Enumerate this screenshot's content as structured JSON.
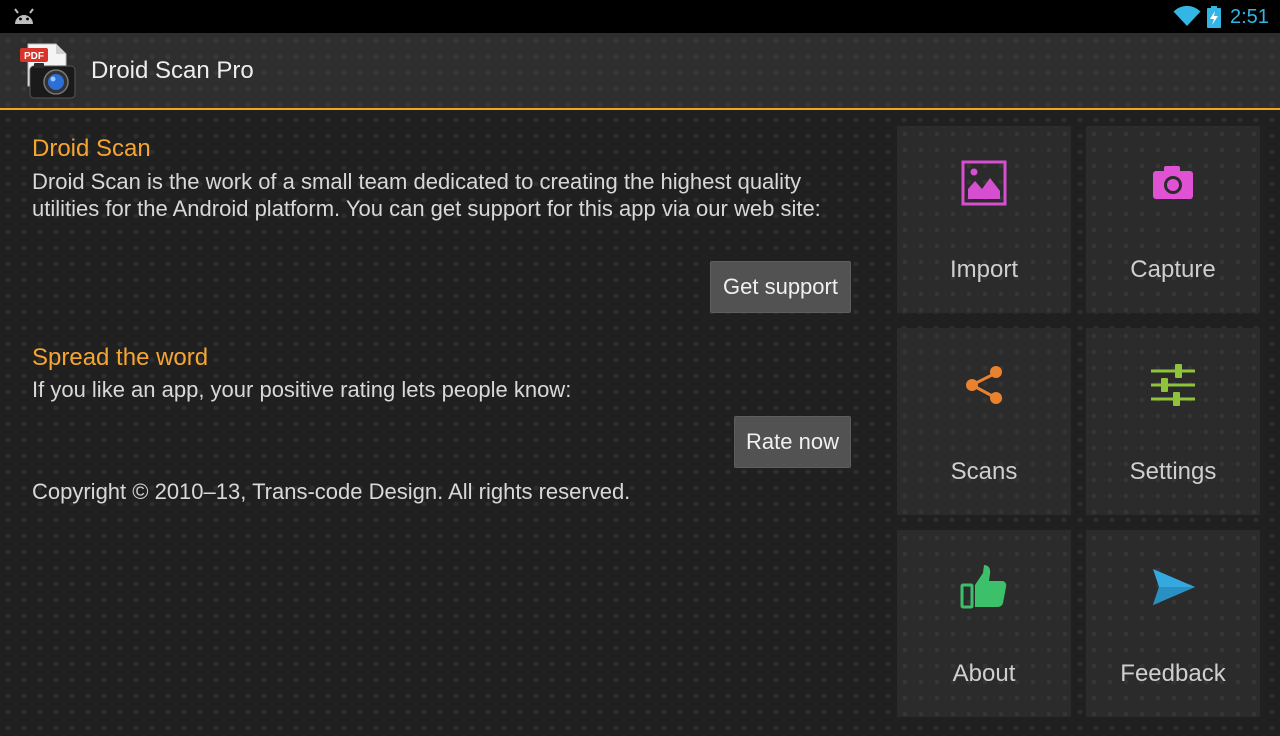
{
  "status_bar": {
    "time": "2:51",
    "icons": [
      "android-debug-icon",
      "wifi-icon",
      "battery-charging-icon"
    ],
    "clock_color": "#33b5e5"
  },
  "action_bar": {
    "title": "Droid Scan Pro",
    "app_icon": "pdf-camera-app-icon",
    "app_icon_badge": "PDF",
    "accent_color": "#f0a51e"
  },
  "about": {
    "section1": {
      "title": "Droid Scan",
      "body": "Droid Scan is the work of a small team dedicated to creating the highest quality utilities for the Android platform. You can get support for this app via our web site:",
      "button": "Get support"
    },
    "section2": {
      "title": "Spread the word",
      "body": "If you like an app, your positive rating lets people know:",
      "button": "Rate now"
    },
    "copyright": "Copyright © 2010–13, Trans-code Design. All rights reserved.",
    "title_color": "#f7a531"
  },
  "tiles": [
    {
      "label": "Import",
      "icon": "image-icon",
      "color": "#d64fd0"
    },
    {
      "label": "Capture",
      "icon": "camera-icon",
      "color": "#e052d4"
    },
    {
      "label": "Scans",
      "icon": "share-icon",
      "color": "#e8822e"
    },
    {
      "label": "Settings",
      "icon": "sliders-icon",
      "color": "#8fc43a"
    },
    {
      "label": "About",
      "icon": "thumbs-up-icon",
      "color": "#3cc06a"
    },
    {
      "label": "Feedback",
      "icon": "send-icon",
      "color": "#35a8e0"
    }
  ]
}
